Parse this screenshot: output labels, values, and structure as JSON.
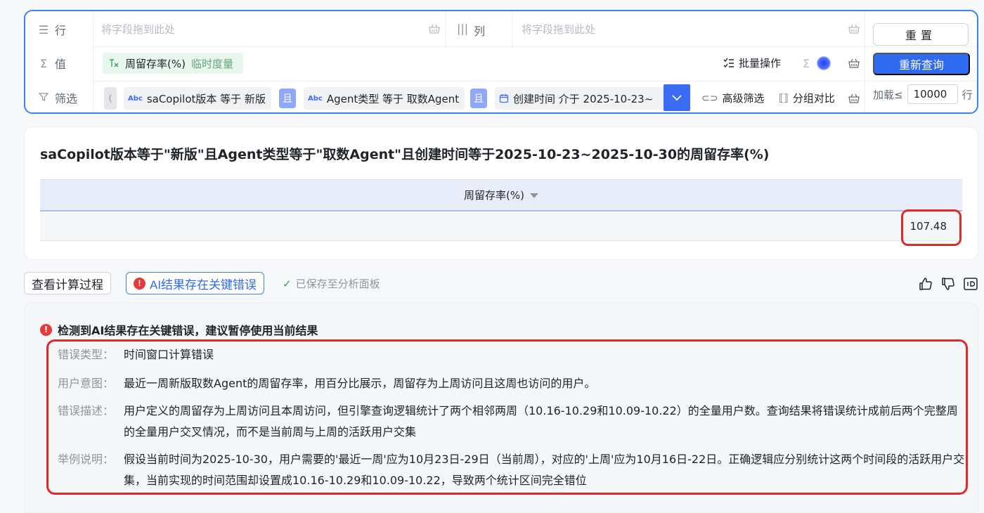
{
  "query": {
    "rows_label": "行",
    "cols_label": "列",
    "values_label": "值",
    "filter_label": "筛选",
    "rows_placeholder": "将字段拖到此处",
    "cols_placeholder": "将字段拖到此处",
    "measure_name": "周留存率(%)",
    "measure_tag": "临时度量",
    "batch_op": "批量操作",
    "sigma": "Σ",
    "filters": [
      {
        "abc": "Abc",
        "text": "saCopilot版本 等于 新版"
      },
      {
        "abc": "Abc",
        "text": "Agent类型 等于 取数Agent"
      },
      {
        "text": "创建时间 介于 2025-10-23~"
      }
    ],
    "and_label": "且",
    "paren": "(",
    "advanced_filter": "高级筛选",
    "group_compare": "分组对比",
    "reset": "重置",
    "requery": "重新查询",
    "load_label": "加载≤",
    "load_value": "10000",
    "load_unit": "行"
  },
  "result": {
    "title": "saCopilot版本等于\"新版\"且Agent类型等于\"取数Agent\"且创建时间等于2025-10-23~2025-10-30的周留存率(%)",
    "column_header": "周留存率(%)",
    "value": "107.48"
  },
  "actions": {
    "view_process": "查看计算过程",
    "ai_error": "AI结果存在关键错误",
    "saved": "已保存至分析面板"
  },
  "error": {
    "head": "检测到AI结果存在关键错误，建议暂停使用当前结果",
    "rows": [
      {
        "label": "错误类型：",
        "text": "时间窗口计算错误"
      },
      {
        "label": "用户意图：",
        "text": "最近一周新版取数Agent的周留存率，用百分比展示，周留存为上周访问且这周也访问的用户。"
      },
      {
        "label": "错误描述：",
        "text": "用户定义的周留存为上周访问且本周访问，但引擎查询逻辑统计了两个相邻两周（10.16-10.29和10.09-10.22）的全量用户数。查询结果将错误统计成前后两个完整周的全量用户交叉情况，而不是当前周与上周的活跃用户交集"
      },
      {
        "label": "举例说明：",
        "text": "假设当前时间为2025-10-30，用户需要的'最近一周'应为10月23日-29日（当前周），对应的'上周'应为10月16日-22日。正确逻辑应分别统计这两个时间段的活跃用户交集，当前实现的时间范围却设置成10.16-10.29和10.09-10.22，导致两个统计区间完全错位"
      }
    ]
  },
  "colors": {
    "primary": "#2f6bf0",
    "error": "#e5393a",
    "highlight_box": "#e02929"
  }
}
